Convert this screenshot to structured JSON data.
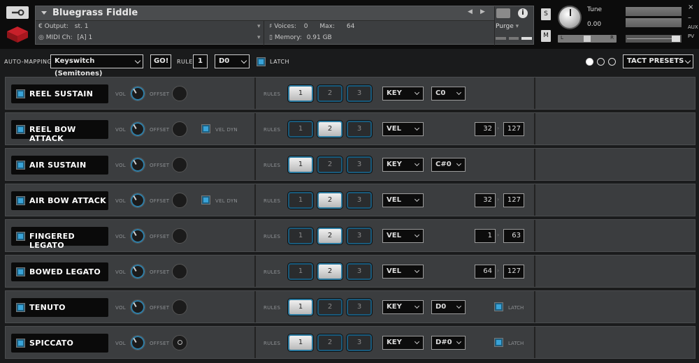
{
  "header": {
    "instrument_name": "Bluegrass Fiddle",
    "output_label": "Output:",
    "output_value": "st. 1",
    "midi_label": "MIDI Ch:",
    "midi_value": "[A]  1",
    "voices_label": "Voices:",
    "voices_value": "0",
    "max_label": "Max:",
    "max_value": "64",
    "memory_label": "Memory:",
    "memory_value": "0.91 GB",
    "purge_label": "Purge",
    "info_label": "i",
    "solo_label": "S",
    "mute_label": "M",
    "tune_label": "Tune",
    "tune_value": "0.00",
    "pan_l": "L",
    "pan_r": "R",
    "aux_label": "AUX",
    "pv_label": "PV",
    "close_label": "×",
    "minimize_label": "–"
  },
  "toolbar": {
    "auto_mapping_label": "AUTO-MAPPING",
    "mode_value": "Keyswitch (Semitones)",
    "go_label": "GO!",
    "rule_label": "RULE",
    "rule_value": "1",
    "key_value": "D0",
    "latch_label": "LATCH",
    "presets_label": "TACT PRESETS"
  },
  "labels": {
    "vol": "VOL",
    "offset": "OFFSET",
    "rules": "RULES",
    "vel_dyn": "VEL DYN",
    "latch": "LATCH"
  },
  "articulations": [
    {
      "name": "REEL SUSTAIN",
      "rule": 1,
      "mode": "KEY",
      "key": "C0"
    },
    {
      "name": "REEL BOW ATTACK",
      "rule": 2,
      "mode": "VEL",
      "min": "32",
      "max": "127",
      "vel_dyn": true
    },
    {
      "name": "AIR SUSTAIN",
      "rule": 1,
      "mode": "KEY",
      "key": "C#0"
    },
    {
      "name": "AIR BOW ATTACK",
      "rule": 2,
      "mode": "VEL",
      "min": "32",
      "max": "127",
      "vel_dyn": true
    },
    {
      "name": "FINGERED LEGATO",
      "rule": 2,
      "mode": "VEL",
      "min": "1",
      "max": "63"
    },
    {
      "name": "BOWED LEGATO",
      "rule": 2,
      "mode": "VEL",
      "min": "64",
      "max": "127"
    },
    {
      "name": "TENUTO",
      "rule": 1,
      "mode": "KEY",
      "key": "D0",
      "latch": true
    },
    {
      "name": "SPICCATO",
      "rule": 1,
      "mode": "KEY",
      "key": "D#0",
      "latch": true
    }
  ],
  "rule_buttons": [
    "1",
    "2",
    "3"
  ],
  "colors": {
    "accent": "#39a3d8",
    "background": "#1a1b1c",
    "row": "#3b3d3f"
  }
}
